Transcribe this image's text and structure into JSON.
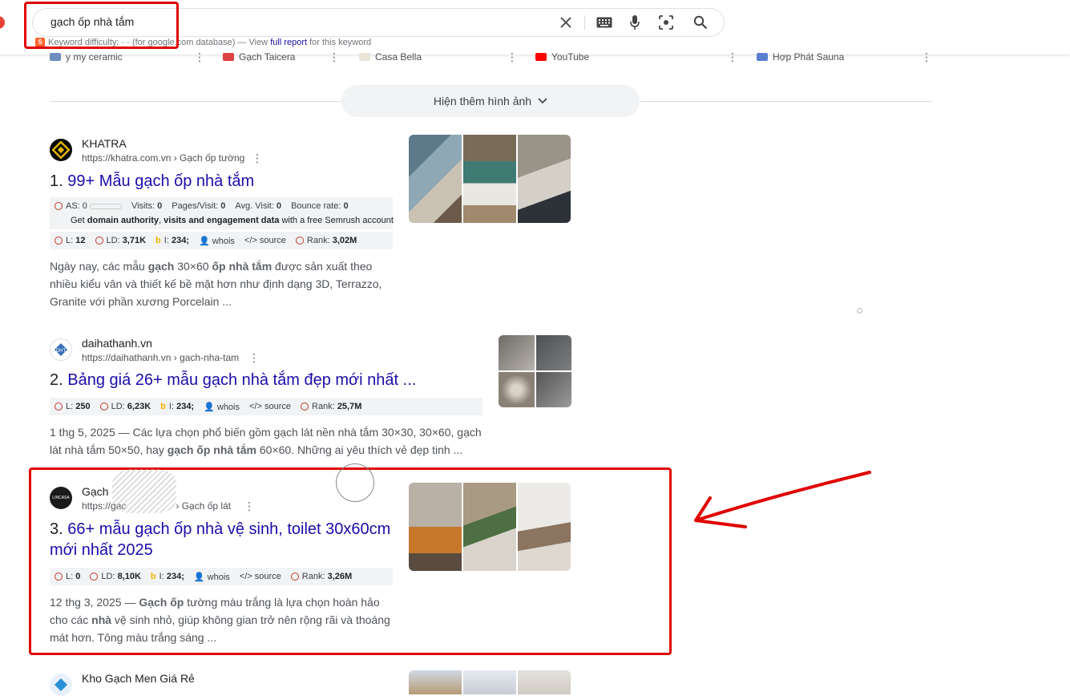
{
  "search": {
    "query": "gạch ốp nhà tắm",
    "keyword_line": {
      "prefix": "Keyword difficulty: ",
      "mid": " (for google.com database) — View ",
      "link": "full report",
      "suffix": " for this keyword"
    }
  },
  "image_sources": [
    {
      "name": "y my ceramic"
    },
    {
      "name": "Gạch Taicera"
    },
    {
      "name": "Casa Bella"
    },
    {
      "name": "YouTube"
    },
    {
      "name": "Hợp Phát Sauna"
    }
  ],
  "more_images": {
    "label": "Hiện thêm hình ảnh"
  },
  "results": [
    {
      "site_name": "KHATRA",
      "url": "https://khatra.com.vn › Gạch ốp tường",
      "num": "1.",
      "title": "99+ Mẫu gạch ốp nhà tắm",
      "semrush": {
        "as": "AS: 0",
        "visits": "0",
        "pages_visit": "0",
        "avg_visit": "0",
        "bounce": "0",
        "cta_1": "Get ",
        "cta_b1": "domain authority",
        "cta_2": ", ",
        "cta_b2": "visits and engagement data",
        "cta_3": " with a free Semrush account"
      },
      "metrics": {
        "l": "12",
        "ld": "3,71K",
        "i": "234;",
        "whois": "whois",
        "source": "source",
        "rank": "3,02M"
      },
      "snippet_parts": [
        "Ngày nay, các mẫu ",
        "gạch",
        " 30×60 ",
        "ốp nhà tắm",
        " được sản xuất theo nhiều kiểu vân và thiết kế bề mặt hơn như định dạng 3D, Terrazzo, Granite với phần xương Porcelain ..."
      ]
    },
    {
      "site_name": "daihathanh.vn",
      "url": "https://daihathanh.vn › gach-nha-tam",
      "num": "2.",
      "title": "Bảng giá 26+ mẫu gạch nhà tắm đẹp mới nhất ...",
      "metrics": {
        "l": "250",
        "ld": "6,23K",
        "i": "234;",
        "whois": "whois",
        "source": "source",
        "rank": "25,7M"
      },
      "snippet_parts": [
        "1 thg 5, 2025 — Các lựa chọn phổ biến gồm gạch lát nền nhà tắm 30×30, 30×60, gạch lát nhà tắm 50×50, hay ",
        "gạch ốp nhà tắm",
        " 60×60. Những ai yêu thích vẻ đẹp tinh ..."
      ]
    },
    {
      "site_name": "Gạch",
      "url": "https://gac",
      "url_tail": "› Gạch ốp lát",
      "num": "3.",
      "title": "66+ mẫu gạch ốp nhà vệ sinh, toilet 30x60cm mới nhất 2025",
      "favicon_text": "LINCASA",
      "metrics": {
        "l": "0",
        "ld": "8,10K",
        "i": "234;",
        "whois": "whois",
        "source": "source",
        "rank": "3,26M"
      },
      "snippet_parts": [
        "12 thg 3, 2025 — ",
        "Gạch ốp",
        " tường màu trắng là lựa chọn hoàn hảo cho các ",
        "nhà",
        " vệ sinh nhỏ, giúp không gian trở nên rộng rãi và thoáng mát hơn. Tông màu trắng sáng ..."
      ]
    },
    {
      "site_name": "Kho Gạch Men Giá Rẻ"
    }
  ],
  "labels": {
    "visits": "Visits:",
    "pages_visit": "Pages/Visit:",
    "avg_visit": "Avg. Visit:",
    "bounce": "Bounce rate:",
    "l": "L:",
    "ld": "LD:",
    "i": "I:",
    "rank": "Rank:"
  },
  "colors": {
    "annotation": "#e00000",
    "link": "#1a0dab",
    "semrush": "#ff642d"
  }
}
